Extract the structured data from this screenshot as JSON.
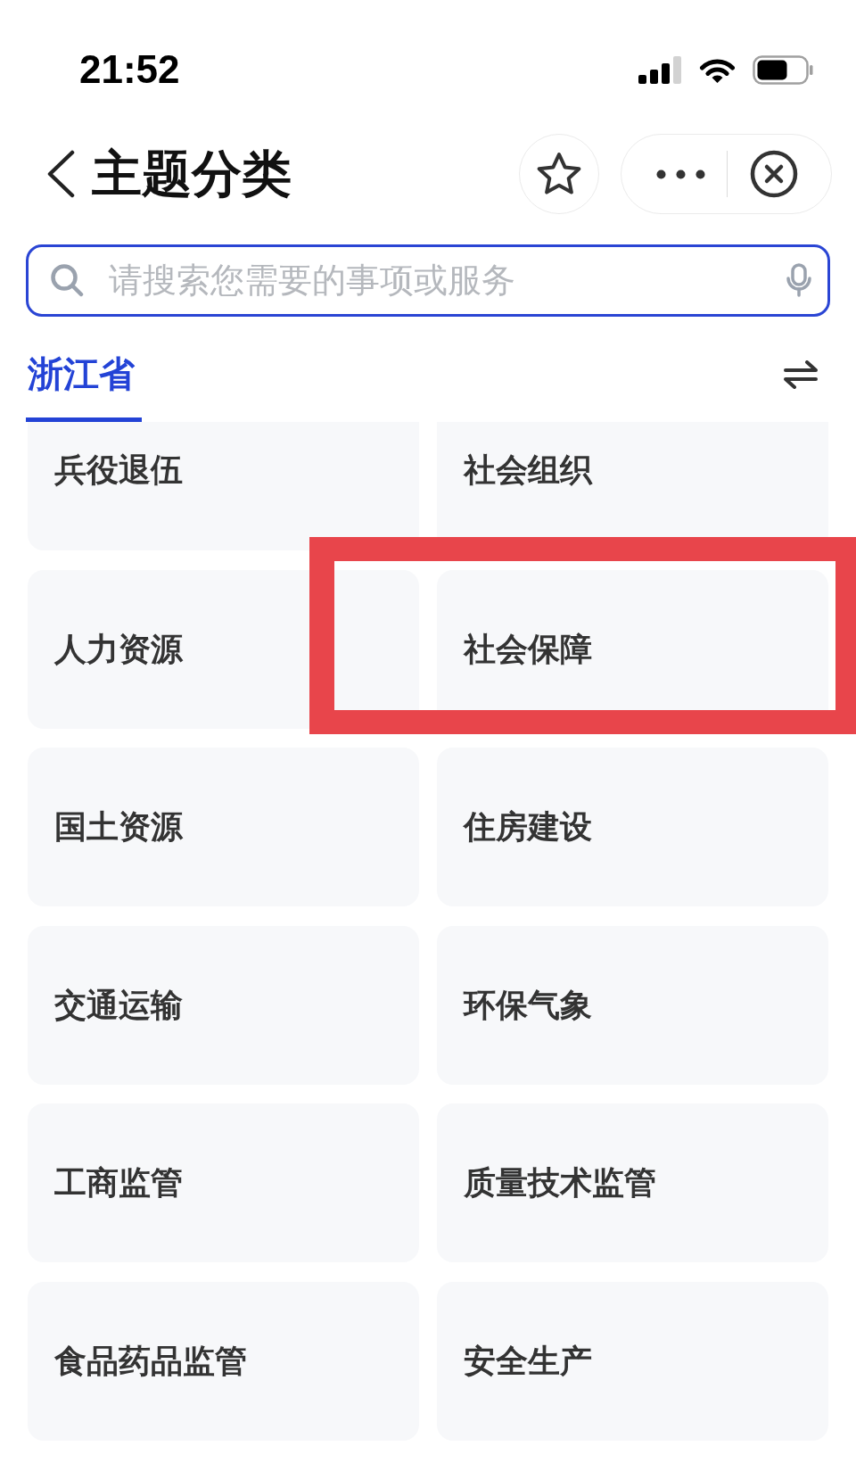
{
  "status_bar": {
    "time": "21:52"
  },
  "header": {
    "title": "主题分类"
  },
  "search": {
    "placeholder": "请搜索您需要的事项或服务"
  },
  "tabs": [
    {
      "label": "浙江省",
      "selected": true
    }
  ],
  "categories": [
    {
      "label": "兵役退伍",
      "highlighted": false
    },
    {
      "label": "社会组织",
      "highlighted": false
    },
    {
      "label": "人力资源",
      "highlighted": false
    },
    {
      "label": "社会保障",
      "highlighted": true
    },
    {
      "label": "国土资源",
      "highlighted": false
    },
    {
      "label": "住房建设",
      "highlighted": false
    },
    {
      "label": "交通运输",
      "highlighted": false
    },
    {
      "label": "环保气象",
      "highlighted": false
    },
    {
      "label": "工商监管",
      "highlighted": false
    },
    {
      "label": "质量技术监管",
      "highlighted": false
    },
    {
      "label": "食品药品监管",
      "highlighted": false
    },
    {
      "label": "安全生产",
      "highlighted": false
    }
  ]
}
